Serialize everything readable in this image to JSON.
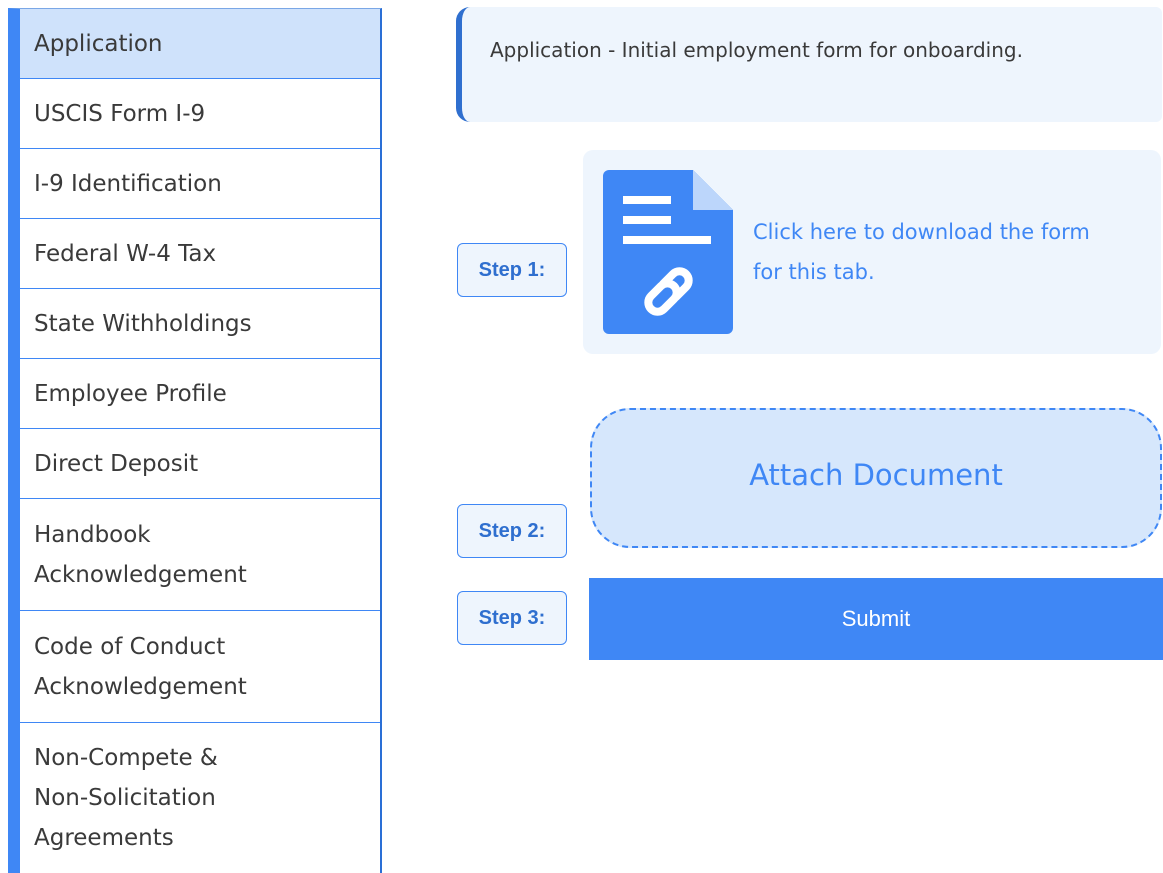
{
  "sidebar": {
    "items": [
      {
        "label": "Application",
        "active": true
      },
      {
        "label": "USCIS Form I-9"
      },
      {
        "label": "I-9 Identification"
      },
      {
        "label": "Federal W-4 Tax"
      },
      {
        "label": "State Withholdings"
      },
      {
        "label": "Employee Profile"
      },
      {
        "label": "Direct Deposit"
      },
      {
        "label": "Handbook Acknowledgement"
      },
      {
        "label": "Code of Conduct Acknowledgement"
      },
      {
        "label": "Non-Compete & Non-Solicitation Agreements"
      }
    ]
  },
  "description": "Application - Initial employment form for onboarding.",
  "steps": {
    "step1": "Step 1:",
    "step2": "Step 2:",
    "step3": "Step 3:"
  },
  "download": {
    "text": "Click here to download the form for this tab.",
    "icon": "document-link-icon"
  },
  "attach_label": "Attach Document",
  "submit_label": "Submit",
  "colors": {
    "accent": "#3f87f5",
    "accent_dark": "#2f6fcf",
    "active_bg": "#cfe2fb",
    "panel_bg": "#eef5fd"
  }
}
